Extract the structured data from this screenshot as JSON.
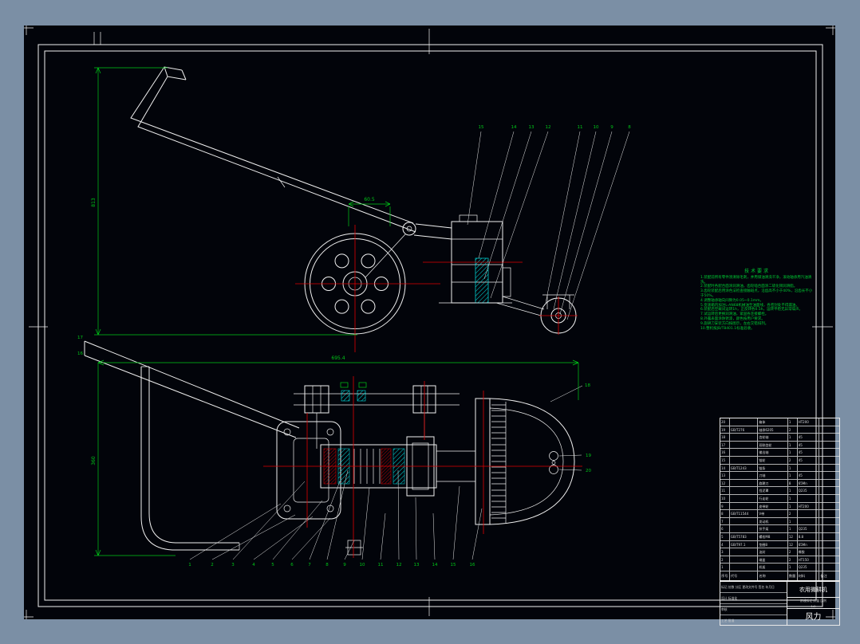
{
  "colors": {
    "background": "#7b8fa5",
    "paper": "#02040a",
    "line": "#f0f0f0",
    "dimension": "#00c818",
    "centerline": "#e00000",
    "hatch": "#00e0e0"
  },
  "notes": {
    "title": "技术要求",
    "lines": [
      "1.装配前所有零件须清除毛刺，并用煤油清洗干净，滚动轴承用汽油清洗。",
      "2.装配时各配合面涂润滑油，齿轮啮合面涂二硫化钼润滑脂。",
      "3.齿轮装配后用涂色法检查接触斑点，沿齿高不小于40%，沿齿长不小于50%。",
      "4.调整轴承轴向间隙为0.05~0.1mm。",
      "5.变速箱内加注L-AN68机械油至油面线，各密封处不得漏油。",
      "6.装配后空载试运转1h，正反转各0.5h，运转平稳无异常噪声。",
      "7.试运转后更换润滑油，紧固各连接螺栓。",
      "8.外露表面涂防锈漆，颜色按用户要求。",
      "9.旋耕刀安装方向按图示，左右交错排列。",
      "10.整机按JB/T8401.1标准验收。"
    ]
  },
  "top_view": {
    "labels": [
      "15",
      "14",
      "13",
      "12",
      "11",
      "10",
      "9",
      "8"
    ],
    "dim_height": "813",
    "dim_width": "60.5"
  },
  "bottom_view": {
    "labels": [
      "1",
      "2",
      "3",
      "4",
      "5",
      "6",
      "7",
      "8",
      "9",
      "10",
      "11",
      "12",
      "13",
      "14",
      "15",
      "16"
    ],
    "side_labels": [
      "18",
      "19",
      "20"
    ],
    "handle_labels": [
      "17",
      "16"
    ],
    "dim_width": "695.4",
    "dim_height": "360"
  },
  "title_block": {
    "header": [
      "序号",
      "代号",
      "名称",
      "数量",
      "材料",
      "备注"
    ],
    "rows": [
      {
        "seq": "20",
        "code": "",
        "name": "箱体",
        "qty": "1",
        "mat": "HT200",
        "note": ""
      },
      {
        "seq": "19",
        "code": "GB/T276",
        "name": "轴承6205",
        "qty": "2",
        "mat": "",
        "note": ""
      },
      {
        "seq": "18",
        "code": "",
        "name": "齿轮轴",
        "qty": "1",
        "mat": "45",
        "note": ""
      },
      {
        "seq": "17",
        "code": "",
        "name": "双联齿轮",
        "qty": "1",
        "mat": "45",
        "note": ""
      },
      {
        "seq": "16",
        "code": "",
        "name": "输出轴",
        "qty": "1",
        "mat": "45",
        "note": ""
      },
      {
        "seq": "15",
        "code": "",
        "name": "链轮",
        "qty": "2",
        "mat": "45",
        "note": ""
      },
      {
        "seq": "14",
        "code": "GB/T1243",
        "name": "链条",
        "qty": "1",
        "mat": "",
        "note": ""
      },
      {
        "seq": "13",
        "code": "",
        "name": "刀轴",
        "qty": "1",
        "mat": "45",
        "note": ""
      },
      {
        "seq": "12",
        "code": "",
        "name": "旋耕刀",
        "qty": "8",
        "mat": "65Mn",
        "note": ""
      },
      {
        "seq": "11",
        "code": "",
        "name": "挡泥罩",
        "qty": "1",
        "mat": "Q235",
        "note": ""
      },
      {
        "seq": "10",
        "code": "",
        "name": "行走轮",
        "qty": "1",
        "mat": "",
        "note": ""
      },
      {
        "seq": "9",
        "code": "",
        "name": "皮带轮",
        "qty": "1",
        "mat": "HT200",
        "note": ""
      },
      {
        "seq": "8",
        "code": "GB/T11544",
        "name": "V带",
        "qty": "2",
        "mat": "",
        "note": ""
      },
      {
        "seq": "7",
        "code": "",
        "name": "发动机",
        "qty": "1",
        "mat": "",
        "note": ""
      },
      {
        "seq": "6",
        "code": "",
        "name": "扶手架",
        "qty": "1",
        "mat": "Q235",
        "note": ""
      },
      {
        "seq": "5",
        "code": "GB/T5783",
        "name": "螺栓M8",
        "qty": "12",
        "mat": "8.8",
        "note": ""
      },
      {
        "seq": "4",
        "code": "GB/T97.1",
        "name": "垫圈8",
        "qty": "12",
        "mat": "65Mn",
        "note": ""
      },
      {
        "seq": "3",
        "code": "",
        "name": "油封",
        "qty": "2",
        "mat": "橡胶",
        "note": ""
      },
      {
        "seq": "2",
        "code": "",
        "name": "端盖",
        "qty": "2",
        "mat": "HT150",
        "note": ""
      },
      {
        "seq": "1",
        "code": "",
        "name": "机架",
        "qty": "1",
        "mat": "Q235",
        "note": ""
      }
    ],
    "revision_rows": [
      "标记 处数 分区 更改文件号 签名 年月日",
      "设计      标准化",
      "审核",
      "工艺      批准"
    ],
    "part_name": "农用微耕机",
    "stage_labels": "阶段标记  质量  比例",
    "scale": "1:2",
    "drawing_label": "风力"
  }
}
